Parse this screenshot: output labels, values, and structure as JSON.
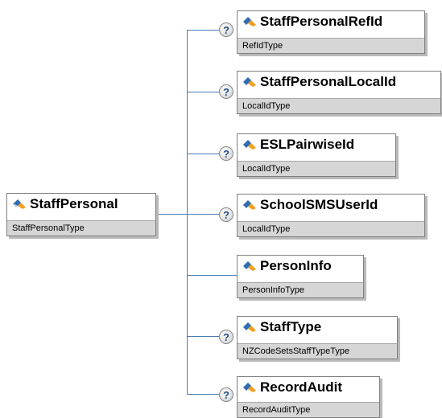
{
  "root": {
    "name": "StaffPersonal",
    "type": "StaffPersonalType"
  },
  "children": [
    {
      "name": "StaffPersonalRefId",
      "type": "RefIdType",
      "optional": true
    },
    {
      "name": "StaffPersonalLocalId",
      "type": "LocalIdType",
      "optional": true
    },
    {
      "name": "ESLPairwiseId",
      "type": "LocalIdType",
      "optional": true
    },
    {
      "name": "SchoolSMSUserId",
      "type": "LocalIdType",
      "optional": true
    },
    {
      "name": "PersonInfo",
      "type": "PersonInfoType",
      "optional": false
    },
    {
      "name": "StaffType",
      "type": "NZCodeSetsStaffTypeType",
      "optional": true
    },
    {
      "name": "RecordAudit",
      "type": "RecordAuditType",
      "optional": true
    }
  ],
  "optional_marker": "?",
  "icon": "element-diamond-icon",
  "colors": {
    "connector": "#4a79b0",
    "type_band": "#d6d6d6",
    "icon_blue": "#2e6db4",
    "icon_orange": "#f0a020"
  }
}
